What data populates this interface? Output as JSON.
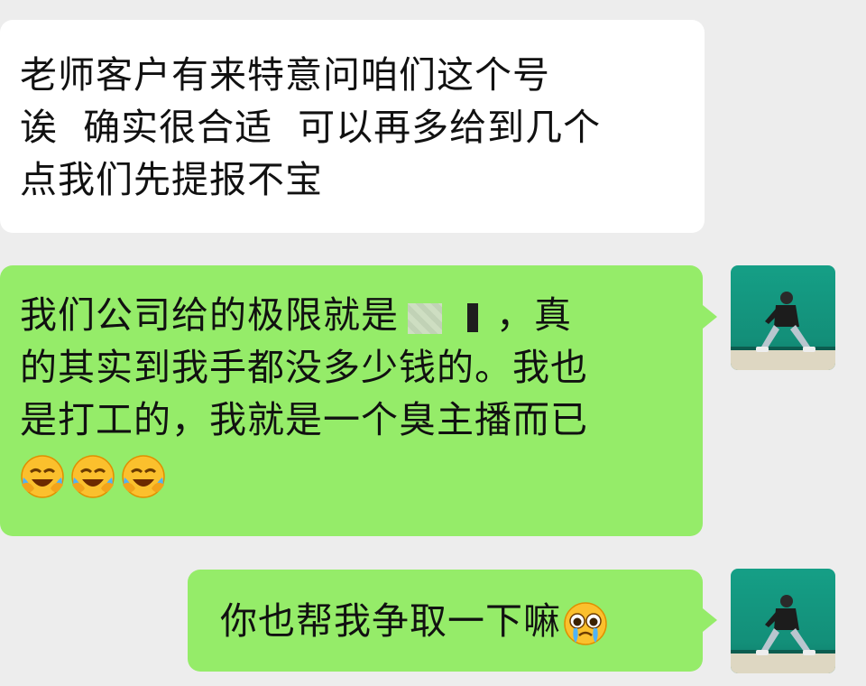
{
  "messages": [
    {
      "side": "left",
      "lines": [
        "老师客户有来特意问咱们这个号",
        "诶  确实很合适  可以再多给到几个",
        "点我们先提报不宝"
      ]
    },
    {
      "side": "right",
      "line1_prefix": "我们公司给的极限就是",
      "line1_suffix": "，真",
      "lines": [
        "的其实到我手都没多少钱的。我也",
        "是打工的，我就是一个臭主播而已"
      ],
      "emojis": [
        "face-with-tears-of-joy-icon",
        "face-with-tears-of-joy-icon",
        "face-with-tears-of-joy-icon"
      ]
    },
    {
      "side": "right",
      "text": "你也帮我争取一下嘛",
      "emoji": "pleading-crying-face-icon"
    }
  ],
  "colors": {
    "background": "#ededed",
    "incoming_bubble": "#ffffff",
    "outgoing_bubble": "#95ec69",
    "avatar_bg": "#159f86"
  }
}
